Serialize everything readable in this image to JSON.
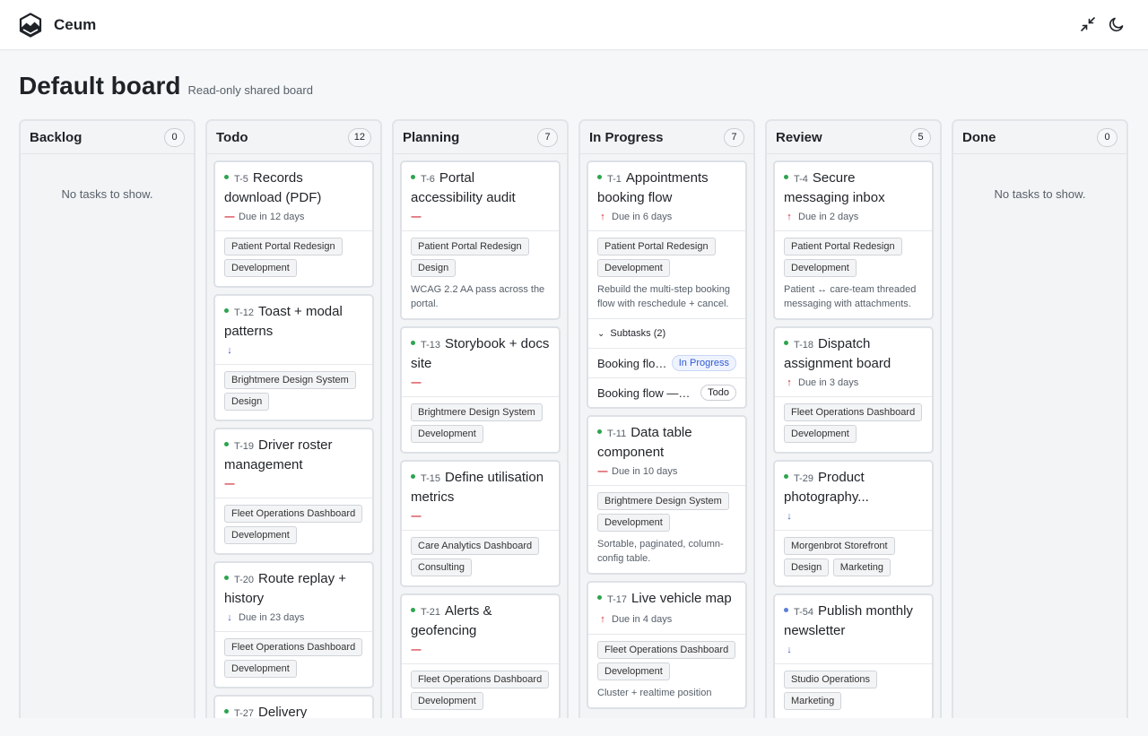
{
  "app": {
    "name": "Ceum"
  },
  "page": {
    "title": "Default board",
    "subtitle": "Read-only shared board"
  },
  "empty_text": "No tasks to show.",
  "subtasks_label": "Subtasks (2)",
  "columns": [
    {
      "title": "Backlog",
      "count": "0"
    },
    {
      "title": "Todo",
      "count": "12"
    },
    {
      "title": "Planning",
      "count": "7"
    },
    {
      "title": "In Progress",
      "count": "7"
    },
    {
      "title": "Review",
      "count": "5"
    },
    {
      "title": "Done",
      "count": "0"
    }
  ],
  "cards": {
    "t5": {
      "id": "T-5",
      "title": "Records download (PDF)",
      "due": "Due in 12 days",
      "tags": [
        "Patient Portal Redesign",
        "Development"
      ]
    },
    "t12": {
      "id": "T-12",
      "title": "Toast + modal patterns",
      "due": "",
      "tags": [
        "Brightmere Design System",
        "Design"
      ]
    },
    "t19": {
      "id": "T-19",
      "title": "Driver roster management",
      "due": "",
      "tags": [
        "Fleet Operations Dashboard",
        "Development"
      ]
    },
    "t20": {
      "id": "T-20",
      "title": "Route replay + history",
      "due": "Due in 23 days",
      "tags": [
        "Fleet Operations Dashboard",
        "Development"
      ]
    },
    "t27": {
      "id": "T-27",
      "title": "Delivery scheduling..."
    },
    "t6": {
      "id": "T-6",
      "title": "Portal accessibility audit",
      "due": "",
      "tags": [
        "Patient Portal Redesign",
        "Design"
      ],
      "desc": "WCAG 2.2 AA pass across the portal."
    },
    "t13": {
      "id": "T-13",
      "title": "Storybook + docs site",
      "due": "",
      "tags": [
        "Brightmere Design System",
        "Development"
      ]
    },
    "t15": {
      "id": "T-15",
      "title": "Define utilisation metrics",
      "due": "",
      "tags": [
        "Care Analytics Dashboard",
        "Consulting"
      ]
    },
    "t21": {
      "id": "T-21",
      "title": "Alerts & geofencing",
      "due": "",
      "tags": [
        "Fleet Operations Dashboard",
        "Development"
      ]
    },
    "t1": {
      "id": "T-1",
      "title": "Appointments booking flow",
      "due": "Due in 6 days",
      "tags": [
        "Patient Portal Redesign",
        "Development"
      ],
      "desc": "Rebuild the multi-step booking flow with reschedule + cancel.",
      "subtasks": [
        {
          "name": "Booking flow — UI",
          "status": "In Progress"
        },
        {
          "name": "Booking flow — API",
          "status": "Todo"
        }
      ]
    },
    "t11": {
      "id": "T-11",
      "title": "Data table component",
      "due": "Due in 10 days",
      "tags": [
        "Brightmere Design System",
        "Development"
      ],
      "desc": "Sortable, paginated, column-config table."
    },
    "t17": {
      "id": "T-17",
      "title": "Live vehicle map",
      "due": "Due in 4 days",
      "tags": [
        "Fleet Operations Dashboard",
        "Development"
      ],
      "desc": "Cluster + realtime position"
    },
    "t4": {
      "id": "T-4",
      "title": "Secure messaging inbox",
      "due": "Due in 2 days",
      "tags": [
        "Patient Portal Redesign",
        "Development"
      ],
      "desc": "Patient ↔ care-team threaded messaging with attachments."
    },
    "t18": {
      "id": "T-18",
      "title": "Dispatch assignment board",
      "due": "Due in 3 days",
      "tags": [
        "Fleet Operations Dashboard",
        "Development"
      ]
    },
    "t29": {
      "id": "T-29",
      "title": "Product photography...",
      "due": "",
      "tags": [
        "Morgenbrot Storefront",
        "Design",
        "Marketing"
      ]
    },
    "t54": {
      "id": "T-54",
      "title": "Publish monthly newsletter",
      "due": "",
      "tags": [
        "Studio Operations",
        "Marketing"
      ]
    }
  },
  "icons": {
    "logo": "hexagon-mountain-logo",
    "collapse": "collapse-icon",
    "theme": "moon-icon"
  }
}
